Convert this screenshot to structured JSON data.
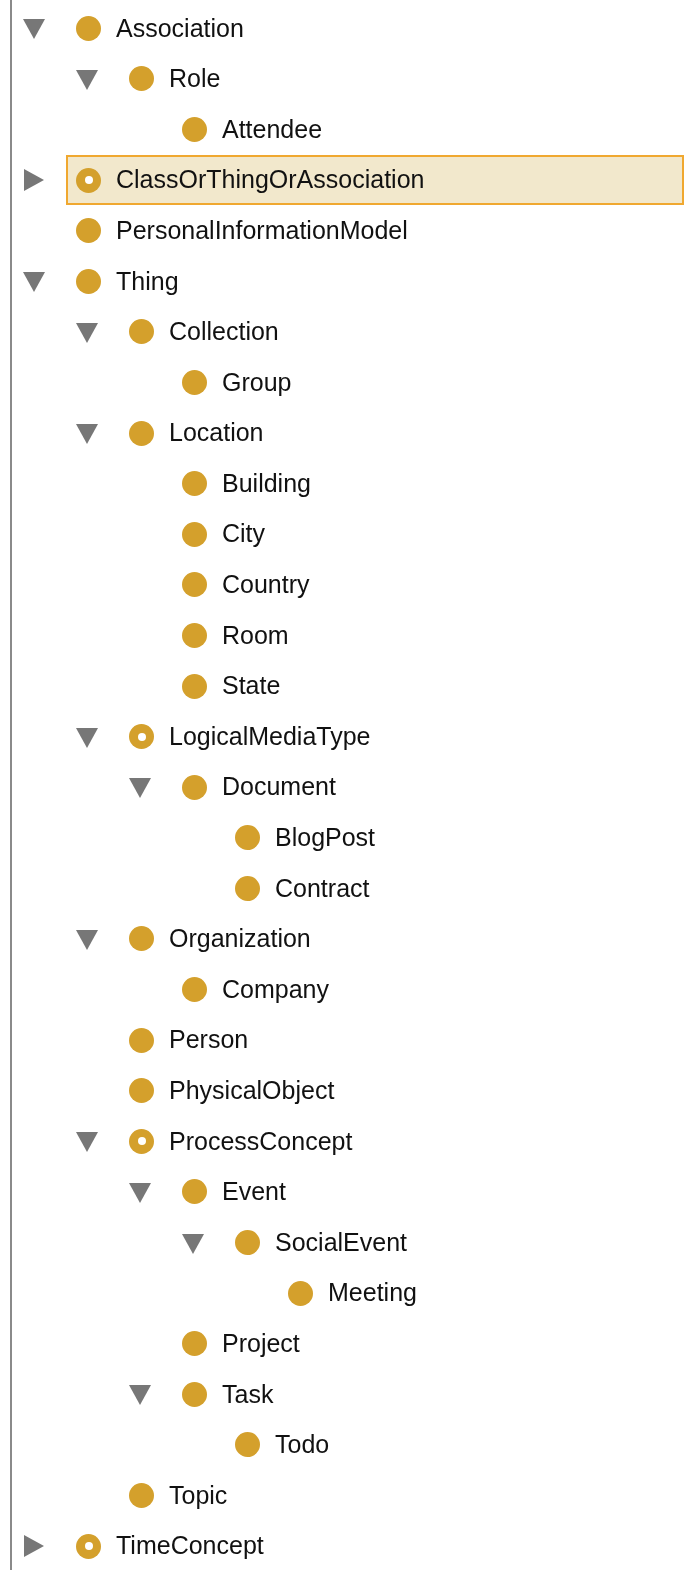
{
  "tree": [
    {
      "label": "Association",
      "defined": false,
      "selected": false,
      "expanded": true,
      "children": [
        {
          "label": "Role",
          "defined": false,
          "selected": false,
          "expanded": true,
          "children": [
            {
              "label": "Attendee",
              "defined": false,
              "selected": false
            }
          ]
        }
      ]
    },
    {
      "label": "ClassOrThingOrAssociation",
      "defined": true,
      "selected": true,
      "expanded": false
    },
    {
      "label": "PersonalInformationModel",
      "defined": false,
      "selected": false
    },
    {
      "label": "Thing",
      "defined": false,
      "selected": false,
      "expanded": true,
      "children": [
        {
          "label": "Collection",
          "defined": false,
          "selected": false,
          "expanded": true,
          "children": [
            {
              "label": "Group",
              "defined": false,
              "selected": false
            }
          ]
        },
        {
          "label": "Location",
          "defined": false,
          "selected": false,
          "expanded": true,
          "children": [
            {
              "label": "Building",
              "defined": false,
              "selected": false
            },
            {
              "label": "City",
              "defined": false,
              "selected": false
            },
            {
              "label": "Country",
              "defined": false,
              "selected": false
            },
            {
              "label": "Room",
              "defined": false,
              "selected": false
            },
            {
              "label": "State",
              "defined": false,
              "selected": false
            }
          ]
        },
        {
          "label": "LogicalMediaType",
          "defined": true,
          "selected": false,
          "expanded": true,
          "children": [
            {
              "label": "Document",
              "defined": false,
              "selected": false,
              "expanded": true,
              "children": [
                {
                  "label": "BlogPost",
                  "defined": false,
                  "selected": false
                },
                {
                  "label": "Contract",
                  "defined": false,
                  "selected": false
                }
              ]
            }
          ]
        },
        {
          "label": "Organization",
          "defined": false,
          "selected": false,
          "expanded": true,
          "children": [
            {
              "label": "Company",
              "defined": false,
              "selected": false
            }
          ]
        },
        {
          "label": "Person",
          "defined": false,
          "selected": false
        },
        {
          "label": "PhysicalObject",
          "defined": false,
          "selected": false
        },
        {
          "label": "ProcessConcept",
          "defined": true,
          "selected": false,
          "expanded": true,
          "children": [
            {
              "label": "Event",
              "defined": false,
              "selected": false,
              "expanded": true,
              "children": [
                {
                  "label": "SocialEvent",
                  "defined": false,
                  "selected": false,
                  "expanded": true,
                  "children": [
                    {
                      "label": "Meeting",
                      "defined": false,
                      "selected": false
                    }
                  ]
                }
              ]
            },
            {
              "label": "Project",
              "defined": false,
              "selected": false
            },
            {
              "label": "Task",
              "defined": false,
              "selected": false,
              "expanded": true,
              "children": [
                {
                  "label": "Todo",
                  "defined": false,
                  "selected": false
                }
              ]
            }
          ]
        },
        {
          "label": "Topic",
          "defined": false,
          "selected": false
        }
      ]
    },
    {
      "label": "TimeConcept",
      "defined": true,
      "selected": false,
      "expanded": false
    }
  ]
}
